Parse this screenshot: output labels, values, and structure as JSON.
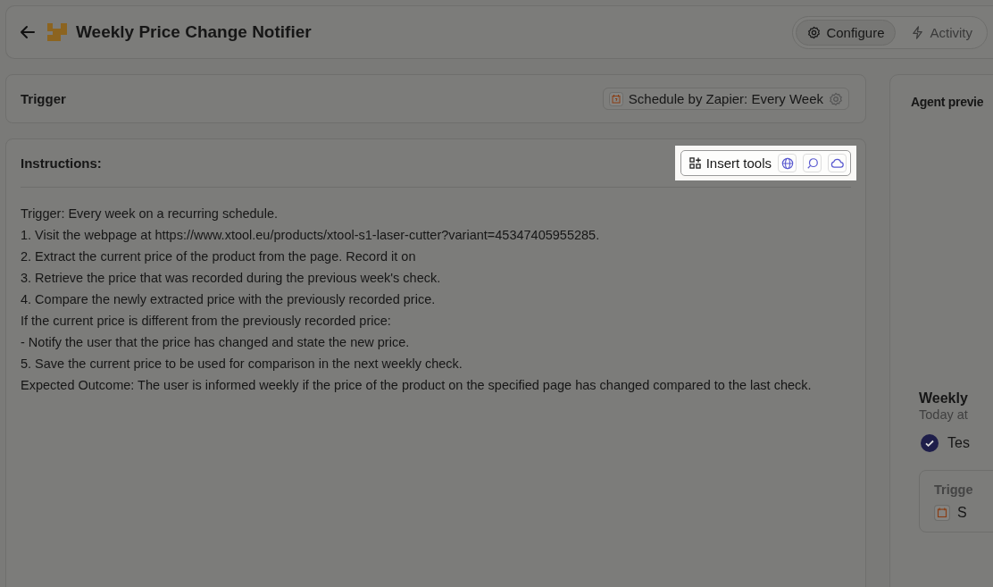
{
  "header": {
    "title": "Weekly Price Change Notifier",
    "tabs": [
      {
        "label": "Configure",
        "kind": "gear",
        "selected": true
      },
      {
        "label": "Activity",
        "kind": "bolt",
        "selected": false
      }
    ]
  },
  "trigger": {
    "label": "Trigger",
    "chip": "Schedule by Zapier: Every Week"
  },
  "instructions": {
    "label": "Instructions:",
    "insert_tools": {
      "label": "Insert tools",
      "tools": [
        {
          "kind": "globe"
        },
        {
          "kind": "search"
        },
        {
          "kind": "cloud"
        }
      ]
    },
    "lines": [
      "Trigger: Every week on a recurring schedule.",
      "1. Visit the webpage at https://www.xtool.eu/products/xtool-s1-laser-cutter?variant=45347405955285.",
      "2. Extract the current price of the product from the page. Record it on",
      "3. Retrieve the price that was recorded during the previous week's check.",
      "4. Compare the newly extracted price with the previously recorded price.",
      "If the current price is different from the previously recorded price:",
      "- Notify the user that the price has changed and state the new price.",
      "5. Save the current price to be used for comparison in the next weekly check.",
      "Expected Outcome: The user is informed weekly if the price of the product on the specified page has changed compared to the last check."
    ]
  },
  "preview": {
    "title": "Agent previe",
    "message": {
      "name": "Weekly",
      "time": "Today at",
      "status": "Tes",
      "card_label": "Trigge",
      "card_value": "S"
    }
  }
}
